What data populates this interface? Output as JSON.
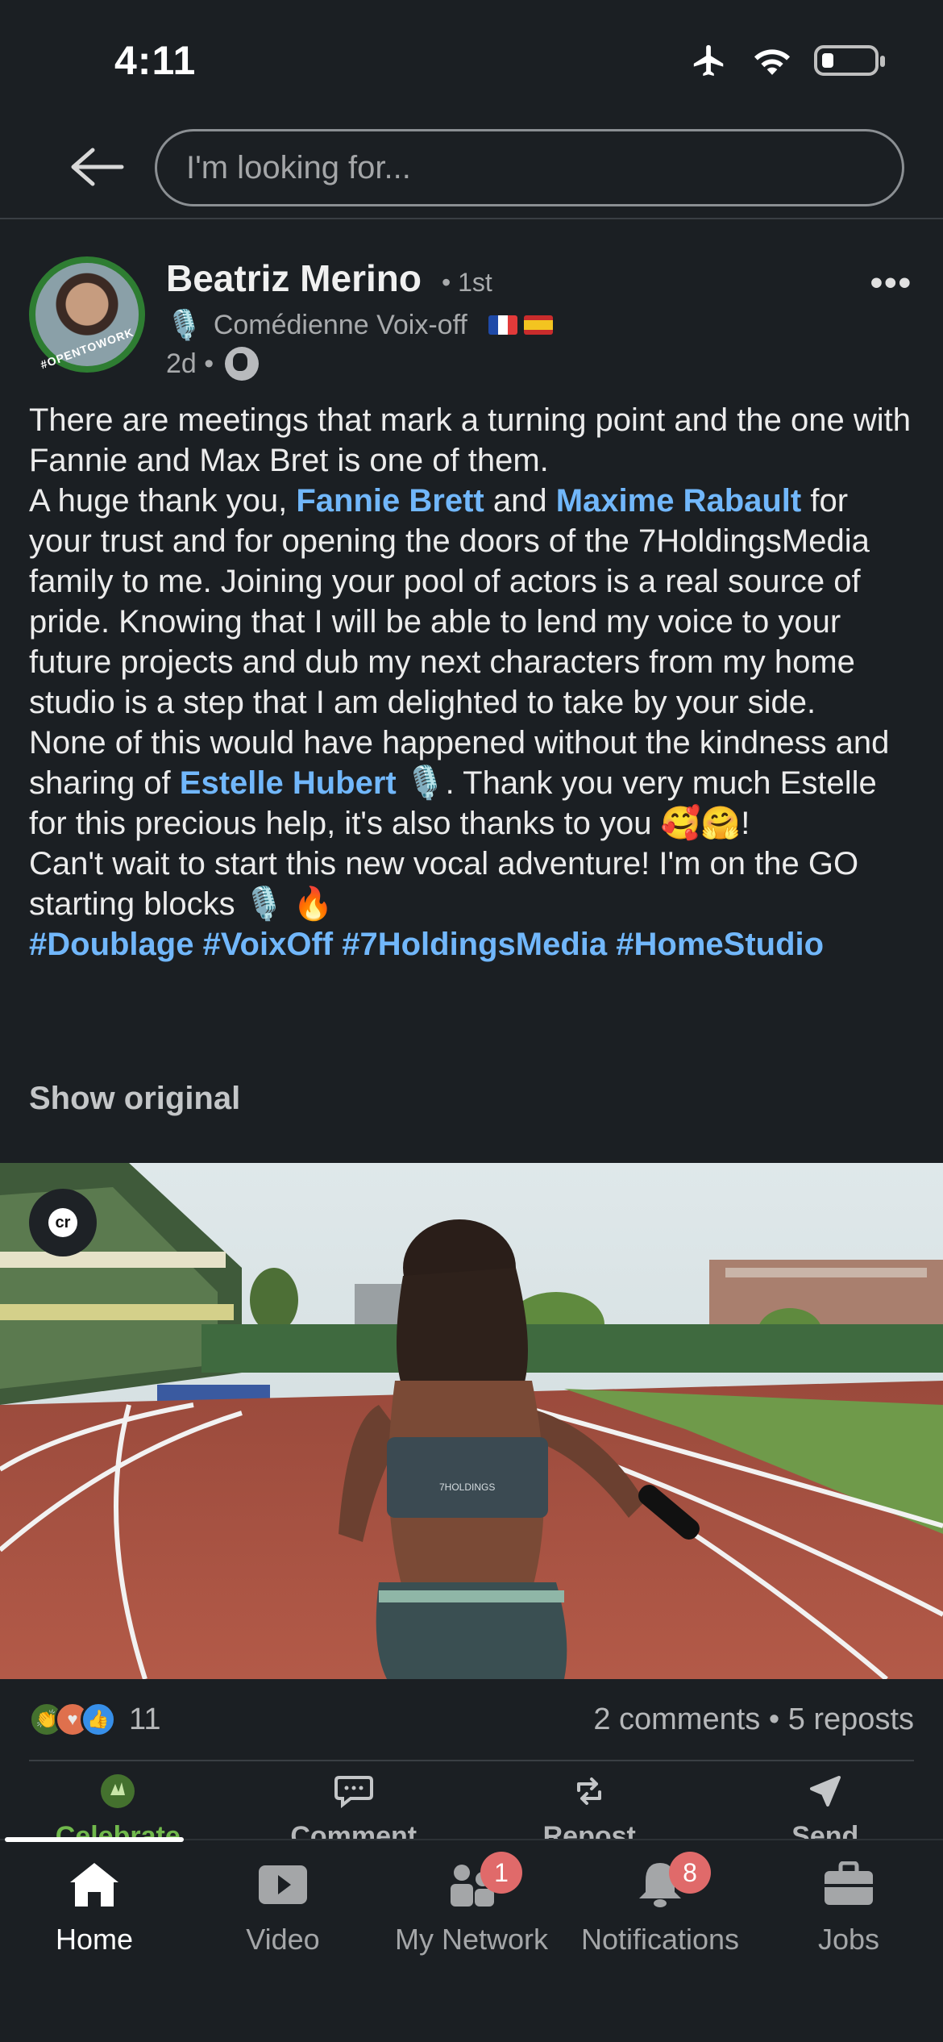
{
  "status_bar": {
    "time": "4:11"
  },
  "search": {
    "placeholder": "I'm looking for..."
  },
  "post": {
    "author": "Beatriz Merino",
    "degree": "• 1st",
    "headline": "Comédienne Voix-off",
    "avatar_tag": "#OPENTOWORK",
    "time_ago": "2d •",
    "text": {
      "line1": "There are meetings that mark a turning point and the one with Fannie and Max Bret is one of them.",
      "thanks_pre": "A huge thank you, ",
      "mention1": "Fannie Brett",
      "and": " and ",
      "mention2": "Maxime Rabault",
      "thanks_post": " for your trust and for opening the doors of the 7HoldingsMedia family to me. Joining your pool of actors is a real source of pride. Knowing that I will be able to lend my voice to your future projects and dub my next characters from my home studio is a step that I am delighted to take by your side.",
      "kindness_pre": "None of this would have happened without the kindness and sharing of ",
      "mention3": "Estelle Hubert",
      "kindness_post": " 🎙️. Thank you very much Estelle for this precious help, it's also thanks to you 🥰🤗!",
      "closing": "Can't wait to start this new vocal adventure! I'm on the GO starting blocks 🎙️ 🔥",
      "hashtags": "#Doublage #VoixOff #7HoldingsMedia #HomeStudio"
    },
    "show_original": "Show original",
    "image_badge": "cr",
    "jersey_text": "7HOLDINGS"
  },
  "social": {
    "reaction_count": "11",
    "comments_reposts": "2 comments • 5 reposts"
  },
  "actions": [
    {
      "label": "Celebrate",
      "icon": "celebrate-icon"
    },
    {
      "label": "Comment",
      "icon": "comment-icon"
    },
    {
      "label": "Repost",
      "icon": "repost-icon"
    },
    {
      "label": "Send",
      "icon": "send-icon"
    }
  ],
  "tabs": [
    {
      "label": "Home",
      "icon": "home-icon",
      "active": true
    },
    {
      "label": "Video",
      "icon": "video-icon"
    },
    {
      "label": "My Network",
      "icon": "network-icon",
      "badge": "1"
    },
    {
      "label": "Notifications",
      "icon": "bell-icon",
      "badge": "8"
    },
    {
      "label": "Jobs",
      "icon": "briefcase-icon"
    }
  ],
  "colors": {
    "background": "#1b1f23",
    "link": "#71b7fb",
    "celebrate_green": "#70b84c",
    "badge_red": "#e06a6a"
  }
}
